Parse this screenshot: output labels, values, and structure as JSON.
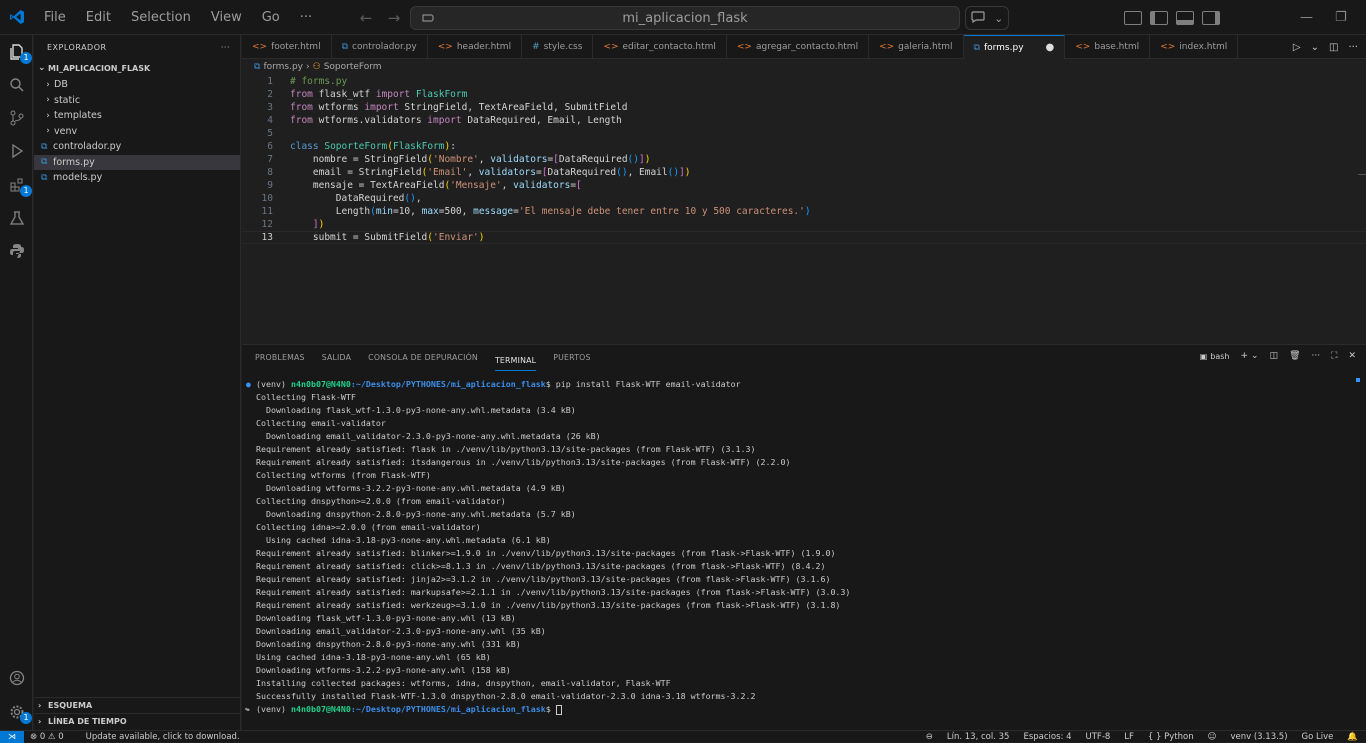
{
  "titlebar": {
    "menu": [
      "File",
      "Edit",
      "Selection",
      "View",
      "Go",
      "···"
    ],
    "search_text": "mi_aplicacion_flask"
  },
  "activity_bar": {
    "explorer_badge": "1",
    "extensions_badge": "1"
  },
  "sidebar": {
    "title": "EXPLORADOR",
    "more": "···",
    "project": "MI_APLICACION_FLASK",
    "items": [
      {
        "label": "DB",
        "type": "folder"
      },
      {
        "label": "static",
        "type": "folder"
      },
      {
        "label": "templates",
        "type": "folder"
      },
      {
        "label": "venv",
        "type": "folder"
      },
      {
        "label": "controlador.py",
        "type": "file"
      },
      {
        "label": "forms.py",
        "type": "file",
        "active": true
      },
      {
        "label": "models.py",
        "type": "file"
      }
    ],
    "sections": [
      "ESQUEMA",
      "LÍNEA DE TIEMPO"
    ]
  },
  "tabs": [
    {
      "label": "footer.html",
      "icon": "<>",
      "color": "#e37933"
    },
    {
      "label": "controlador.py",
      "icon": "⧉",
      "color": "#3b8ed0"
    },
    {
      "label": "header.html",
      "icon": "<>",
      "color": "#e37933"
    },
    {
      "label": "style.css",
      "icon": "#",
      "color": "#519aba"
    },
    {
      "label": "editar_contacto.html",
      "icon": "<>",
      "color": "#e37933"
    },
    {
      "label": "agregar_contacto.html",
      "icon": "<>",
      "color": "#e37933"
    },
    {
      "label": "galeria.html",
      "icon": "<>",
      "color": "#e37933"
    },
    {
      "label": "forms.py",
      "icon": "⧉",
      "color": "#3b8ed0",
      "active": true,
      "modified": "●"
    },
    {
      "label": "base.html",
      "icon": "<>",
      "color": "#e37933"
    },
    {
      "label": "index.html",
      "icon": "<>",
      "color": "#e37933"
    }
  ],
  "breadcrumb": {
    "file": "forms.py",
    "sep": "›",
    "symbol": "SoporteForm"
  },
  "editor": {
    "line_numbers": [
      "1",
      "2",
      "3",
      "4",
      "5",
      "6",
      "7",
      "8",
      "9",
      "10",
      "11",
      "12",
      "13"
    ],
    "current_line": 13
  },
  "panel": {
    "tabs": [
      "PROBLEMAS",
      "SALIDA",
      "CONSOLA DE DEPURACIÓN",
      "TERMINAL",
      "PUERTOS"
    ],
    "active_tab": "TERMINAL",
    "shell": "bash",
    "terminal": {
      "prompt_venv": "(venv) ",
      "prompt_user": "n4n0b07@N4N0",
      "prompt_path": ":~/Desktop/PYTHONES/mi_aplicacion_flask",
      "prompt_end": "$ ",
      "command": "pip install Flask-WTF email-validator",
      "output": [
        "Collecting Flask-WTF",
        "  Downloading flask_wtf-1.3.0-py3-none-any.whl.metadata (3.4 kB)",
        "Collecting email-validator",
        "  Downloading email_validator-2.3.0-py3-none-any.whl.metadata (26 kB)",
        "Requirement already satisfied: flask in ./venv/lib/python3.13/site-packages (from Flask-WTF) (3.1.3)",
        "Requirement already satisfied: itsdangerous in ./venv/lib/python3.13/site-packages (from Flask-WTF) (2.2.0)",
        "Collecting wtforms (from Flask-WTF)",
        "  Downloading wtforms-3.2.2-py3-none-any.whl.metadata (4.9 kB)",
        "Collecting dnspython>=2.0.0 (from email-validator)",
        "  Downloading dnspython-2.8.0-py3-none-any.whl.metadata (5.7 kB)",
        "Collecting idna>=2.0.0 (from email-validator)",
        "  Using cached idna-3.18-py3-none-any.whl.metadata (6.1 kB)",
        "Requirement already satisfied: blinker>=1.9.0 in ./venv/lib/python3.13/site-packages (from flask->Flask-WTF) (1.9.0)",
        "Requirement already satisfied: click>=8.1.3 in ./venv/lib/python3.13/site-packages (from flask->Flask-WTF) (8.4.2)",
        "Requirement already satisfied: jinja2>=3.1.2 in ./venv/lib/python3.13/site-packages (from flask->Flask-WTF) (3.1.6)",
        "Requirement already satisfied: markupsafe>=2.1.1 in ./venv/lib/python3.13/site-packages (from flask->Flask-WTF) (3.0.3)",
        "Requirement already satisfied: werkzeug>=3.1.0 in ./venv/lib/python3.13/site-packages (from flask->Flask-WTF) (3.1.8)",
        "Downloading flask_wtf-1.3.0-py3-none-any.whl (13 kB)",
        "Downloading email_validator-2.3.0-py3-none-any.whl (35 kB)",
        "Downloading dnspython-2.8.0-py3-none-any.whl (331 kB)",
        "Using cached idna-3.18-py3-none-any.whl (65 kB)",
        "Downloading wtforms-3.2.2-py3-none-any.whl (158 kB)",
        "Installing collected packages: wtforms, idna, dnspython, email-validator, Flask-WTF",
        "Successfully installed Flask-WTF-1.3.0 dnspython-2.8.0 email-validator-2.3.0 idna-3.18 wtforms-3.2.2"
      ]
    }
  },
  "statusbar": {
    "problems": "⊗ 0 ⚠ 0",
    "update": "Update available, click to download.",
    "position": "Lín. 13, col. 35",
    "spaces": "Espacios: 4",
    "encoding": "UTF-8",
    "eol": "LF",
    "language": "{ } Python",
    "venv": "venv (3.13.5)",
    "golive": "Go Live"
  },
  "colors": {
    "accent": "#0078d4",
    "terminal_user": "#23d18b",
    "terminal_path": "#3b8eea"
  }
}
